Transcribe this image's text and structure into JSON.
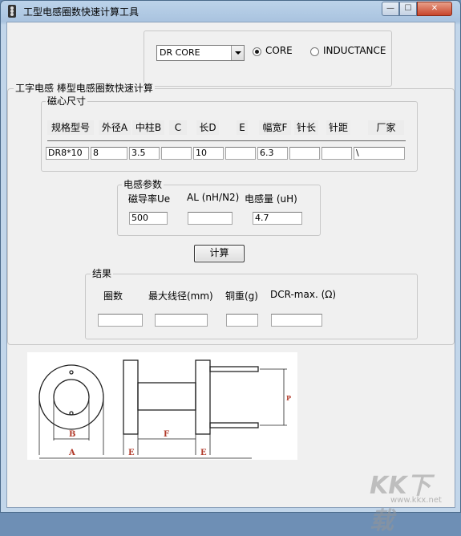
{
  "window": {
    "title": "工型电感圈数快速计算工具"
  },
  "mode": {
    "core_select": "DR CORE",
    "radio_core": "CORE",
    "radio_inductance": "INDUCTANCE",
    "selected": "CORE"
  },
  "main_group": {
    "title": "工字电感 棒型电感圈数快速计算"
  },
  "core_dims": {
    "title": "磁心尺寸",
    "headers": [
      "规格型号",
      "外径A",
      "中柱B",
      "C",
      "长D",
      "E",
      "幅宽F",
      "针长",
      "针距",
      "厂家"
    ],
    "values": [
      "DR8*10",
      "8",
      "3.5",
      "",
      "10",
      "",
      "6.3",
      "",
      "",
      "\\"
    ]
  },
  "inductor_params": {
    "title": "电感参数",
    "permeability_label": "磁导率Ue",
    "al_label": "AL (nH/N2)",
    "inductance_label": "电感量 (uH)",
    "permeability_value": "500",
    "al_value": "",
    "inductance_value": "4.7"
  },
  "calc_button": "计算",
  "results": {
    "title": "结果",
    "turns_label": "圈数",
    "max_wire_label": "最大线径(mm)",
    "copper_weight_label": "铜重(g)",
    "dcr_label": "DCR-max. (Ω)",
    "turns_value": "",
    "max_wire_value": "",
    "copper_weight_value": "",
    "dcr_value": ""
  },
  "diagram": {
    "labels": [
      "B",
      "A",
      "F",
      "E",
      "E",
      "P"
    ]
  },
  "watermark": {
    "logo": "KK下载",
    "url": "www.kkx.net"
  }
}
